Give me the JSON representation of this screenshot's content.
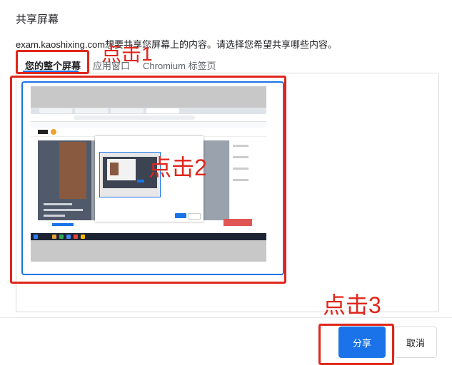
{
  "dialog": {
    "title": "共享屏幕",
    "subtitle": "exam.kaoshixing.com想要共享您屏幕上的内容。请选择您希望共享哪些内容。"
  },
  "tabs": [
    {
      "label": "您的整个屏幕",
      "active": true
    },
    {
      "label": "应用窗口",
      "active": false
    },
    {
      "label": "Chromium 标签页",
      "active": false
    }
  ],
  "thumbnail": {
    "selected": true
  },
  "buttons": {
    "share_label": "分享",
    "cancel_label": "取消"
  },
  "annotations": [
    {
      "label": "点击1"
    },
    {
      "label": "点击2"
    },
    {
      "label": "点击3"
    }
  ],
  "colors": {
    "accent": "#1a73e8",
    "annotation_red": "#e0261b",
    "text": "#202124",
    "border": "#dadce0"
  }
}
